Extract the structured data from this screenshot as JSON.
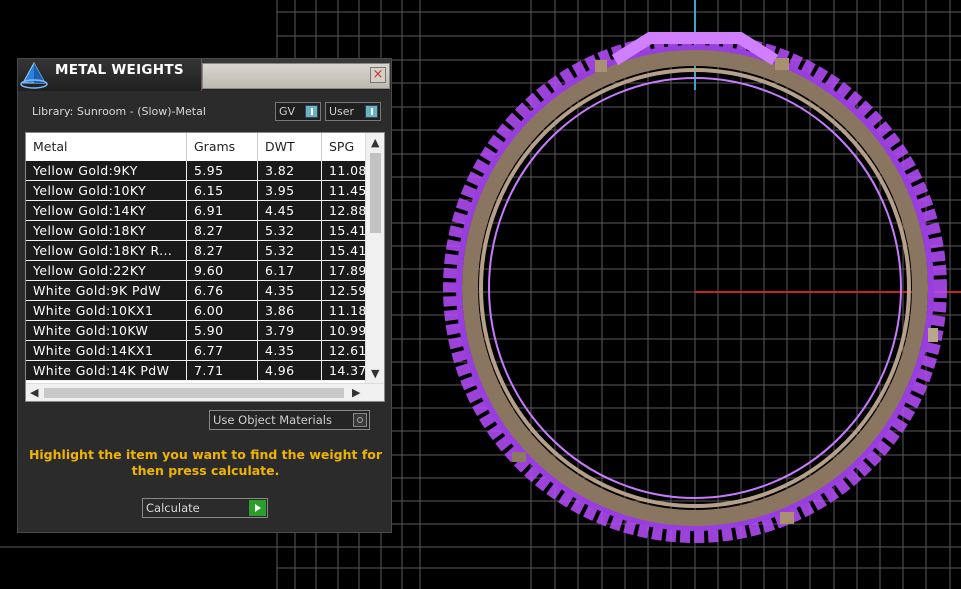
{
  "panel": {
    "title": "METAL WEIGHTS",
    "close_label": "×",
    "library_label": "Library: Sunroom - (Slow)-Metal",
    "toggle_gv": "GV",
    "toggle_user": "User",
    "use_object_materials": "Use Object Materials",
    "instructions": "Highlight the item you want to find the weight for then press calculate.",
    "calculate_label": "Calculate"
  },
  "table": {
    "columns": [
      "Metal",
      "Grams",
      "DWT",
      "SPG"
    ],
    "rows": [
      [
        "Yellow Gold:9KY",
        "5.95",
        "3.82",
        "11.08"
      ],
      [
        "Yellow Gold:10KY",
        "6.15",
        "3.95",
        "11.45"
      ],
      [
        "Yellow Gold:14KY",
        "6.91",
        "4.45",
        "12.88"
      ],
      [
        "Yellow Gold:18KY",
        "8.27",
        "5.32",
        "15.41"
      ],
      [
        "Yellow Gold:18KY R...",
        "8.27",
        "5.32",
        "15.41"
      ],
      [
        "Yellow Gold:22KY",
        "9.60",
        "6.17",
        "17.89"
      ],
      [
        "White Gold:9K PdW",
        "6.76",
        "4.35",
        "12.59"
      ],
      [
        "White Gold:10KX1",
        "6.00",
        "3.86",
        "11.18"
      ],
      [
        "White Gold:10KW",
        "5.90",
        "3.79",
        "10.99"
      ],
      [
        "White Gold:14KX1",
        "6.77",
        "4.35",
        "12.61"
      ],
      [
        "White Gold:14K PdW",
        "7.71",
        "4.96",
        "14.37"
      ]
    ]
  },
  "colors": {
    "viewport_bg": "#000000",
    "grid": "#5a5a5a",
    "ring_purple": "#b84dff",
    "ring_band": "#8a7560",
    "axis_blue": "#3aa6c8",
    "axis_red": "#c0281f",
    "instruction_text": "#f0b400"
  },
  "icons": {
    "logo": "gem-pyramid-icon",
    "close": "close-icon",
    "calculate": "play-icon"
  }
}
